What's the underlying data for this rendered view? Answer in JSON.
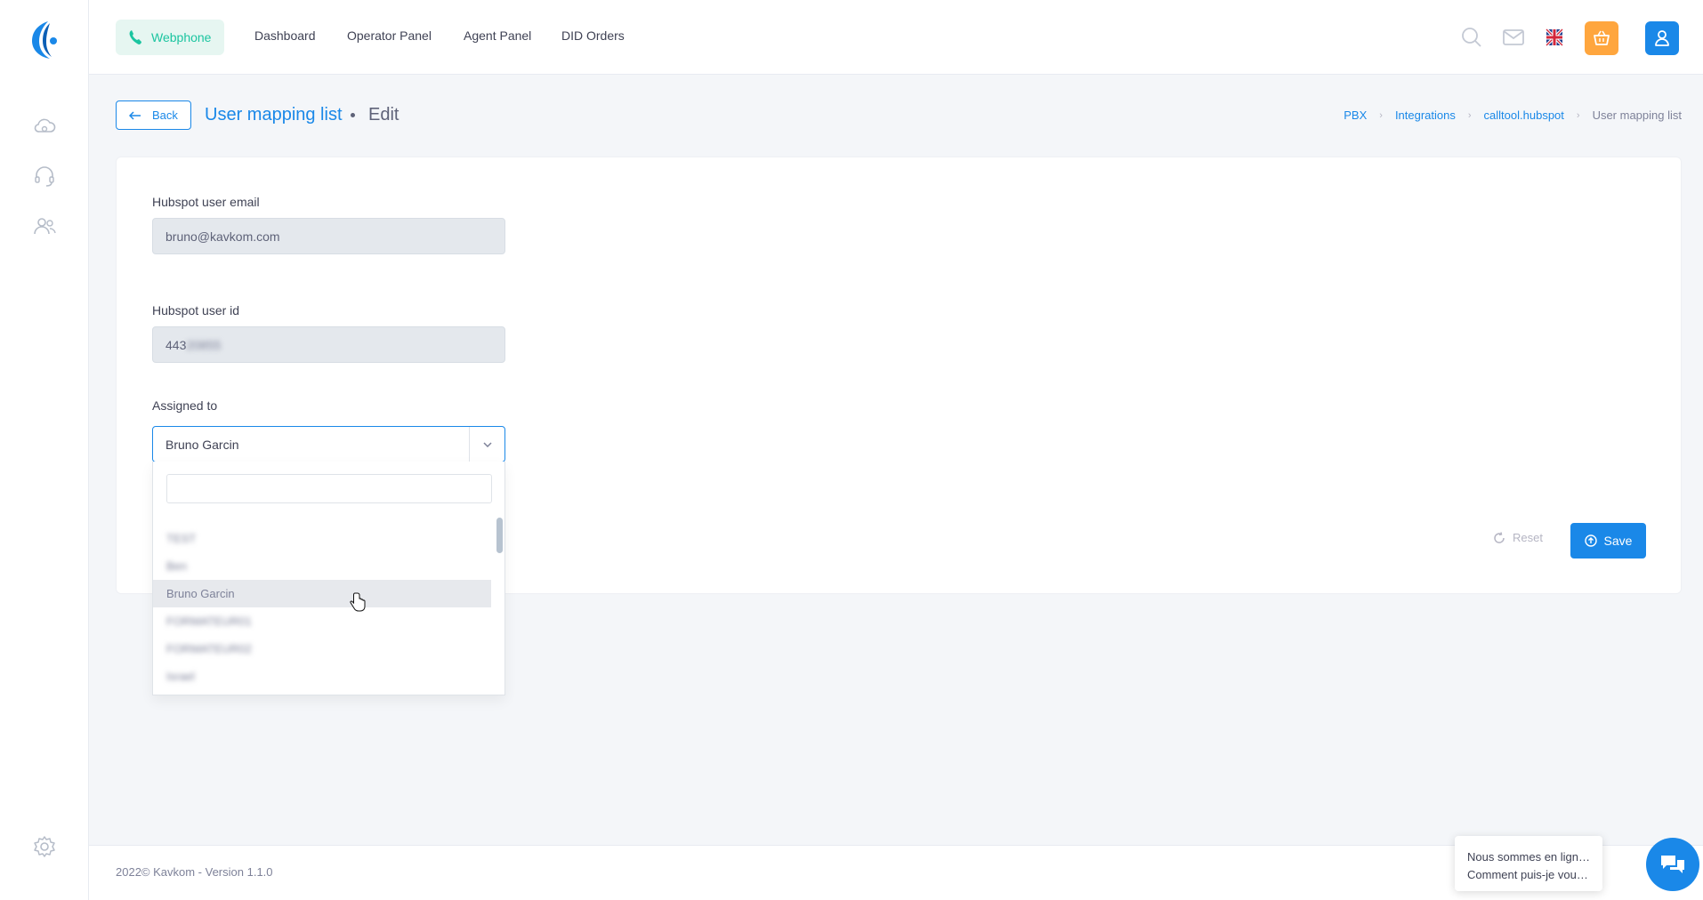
{
  "header": {
    "webphone_label": "Webphone",
    "nav": [
      "Dashboard",
      "Operator Panel",
      "Agent Panel",
      "DID Orders"
    ]
  },
  "page": {
    "back_label": "Back",
    "title": "User mapping list",
    "subtitle": "Edit"
  },
  "breadcrumb": [
    "PBX",
    "Integrations",
    "calltool.hubspot",
    "User mapping list"
  ],
  "form": {
    "email_label": "Hubspot user email",
    "email_value": "bruno@kavkom.com",
    "userid_label": "Hubspot user id",
    "userid_value_visible": "443",
    "userid_value_hidden": "20855",
    "assigned_label": "Assigned to",
    "assigned_value": "Bruno Garcin",
    "dropdown_options": [
      "TEST",
      "Ben",
      "Bruno Garcin",
      "FORMATEUR01",
      "FORMATEUR02",
      "Israel"
    ],
    "dropdown_active_index": 2,
    "reset_label": "Reset",
    "save_label": "Save"
  },
  "footer": {
    "copyright": "2022© Kavkom - Version 1.1.0"
  },
  "chat": {
    "line1": "Nous sommes en ligne !",
    "line2": "Comment puis-je vous aider ?"
  },
  "colors": {
    "primary": "#1a88e8",
    "success": "#1bc5a0",
    "warning": "#ffa63e"
  }
}
